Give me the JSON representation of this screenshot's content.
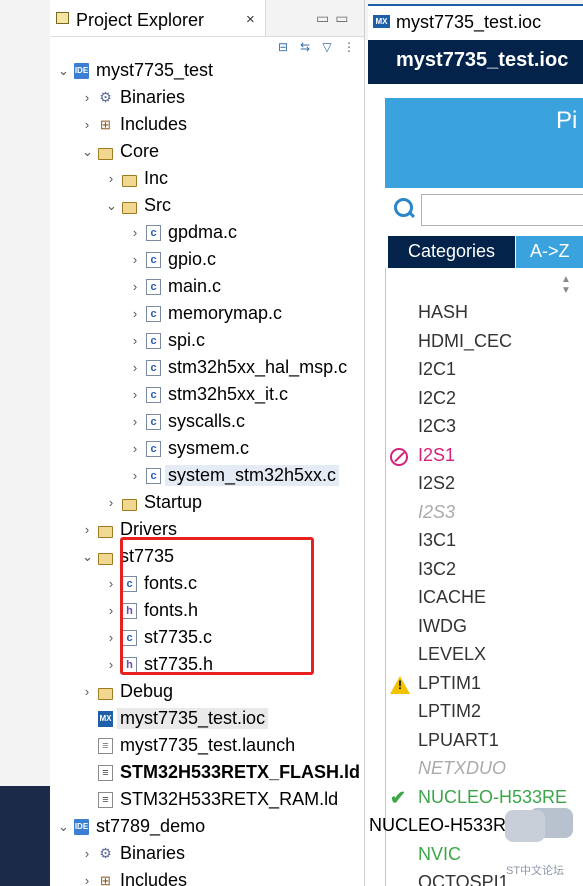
{
  "project_explorer": {
    "tab_title": "Project Explorer",
    "tab_close": "×",
    "min_max": "▭▭",
    "toolbar": [
      "collapse-all-icon",
      "link-with-editor-icon",
      "filter-icon",
      "view-menu-icon"
    ],
    "tree": [
      {
        "label": "myst7735_test",
        "icon": "project-icon",
        "toggle": "v",
        "indent": 0
      },
      {
        "label": "Binaries",
        "icon": "binaries-icon",
        "toggle": ">",
        "indent": 1
      },
      {
        "label": "Includes",
        "icon": "includes-icon",
        "toggle": ">",
        "indent": 1
      },
      {
        "label": "Core",
        "icon": "folder-icon",
        "toggle": "v",
        "indent": 1
      },
      {
        "label": "Inc",
        "icon": "folder-icon",
        "toggle": ">",
        "indent": 2
      },
      {
        "label": "Src",
        "icon": "folder-icon",
        "toggle": "v",
        "indent": 2
      },
      {
        "label": "gpdma.c",
        "icon": "c-file-icon",
        "toggle": ">",
        "indent": 3
      },
      {
        "label": "gpio.c",
        "icon": "c-file-icon",
        "toggle": ">",
        "indent": 3
      },
      {
        "label": "main.c",
        "icon": "c-file-icon",
        "toggle": ">",
        "indent": 3
      },
      {
        "label": "memorymap.c",
        "icon": "c-file-icon",
        "toggle": ">",
        "indent": 3
      },
      {
        "label": "spi.c",
        "icon": "c-file-icon",
        "toggle": ">",
        "indent": 3
      },
      {
        "label": "stm32h5xx_hal_msp.c",
        "icon": "c-file-icon",
        "toggle": ">",
        "indent": 3
      },
      {
        "label": "stm32h5xx_it.c",
        "icon": "c-file-icon",
        "toggle": ">",
        "indent": 3
      },
      {
        "label": "syscalls.c",
        "icon": "c-file-icon",
        "toggle": ">",
        "indent": 3
      },
      {
        "label": "sysmem.c",
        "icon": "c-file-icon",
        "toggle": ">",
        "indent": 3
      },
      {
        "label": "system_stm32h5xx.c",
        "icon": "c-file-icon",
        "toggle": ">",
        "indent": 3,
        "selected": true
      },
      {
        "label": "Startup",
        "icon": "folder-icon",
        "toggle": ">",
        "indent": 2
      },
      {
        "label": "Drivers",
        "icon": "folder-icon",
        "toggle": ">",
        "indent": 1
      },
      {
        "label": "st7735",
        "icon": "folder-icon",
        "toggle": "v",
        "indent": 1
      },
      {
        "label": "fonts.c",
        "icon": "c-file-icon",
        "toggle": ">",
        "indent": 2
      },
      {
        "label": "fonts.h",
        "icon": "h-file-icon",
        "toggle": ">",
        "indent": 2
      },
      {
        "label": "st7735.c",
        "icon": "c-file-icon",
        "toggle": ">",
        "indent": 2
      },
      {
        "label": "st7735.h",
        "icon": "h-file-icon",
        "toggle": ">",
        "indent": 2
      },
      {
        "label": "Debug",
        "icon": "folder-icon",
        "toggle": ">",
        "indent": 1
      },
      {
        "label": "myst7735_test.ioc",
        "icon": "mx-file-icon",
        "toggle": "",
        "indent": 1,
        "selected2": true
      },
      {
        "label": "myst7735_test.launch",
        "icon": "launch-file-icon",
        "toggle": "",
        "indent": 1
      },
      {
        "label": "STM32H533RETX_FLASH.ld",
        "icon": "ld-file-icon",
        "toggle": "",
        "indent": 1,
        "bold": true
      },
      {
        "label": "STM32H533RETX_RAM.ld",
        "icon": "ld-file-icon",
        "toggle": "",
        "indent": 1
      },
      {
        "label": "st7789_demo",
        "icon": "project-icon",
        "toggle": "v",
        "indent": 0
      },
      {
        "label": "Binaries",
        "icon": "binaries-icon",
        "toggle": ">",
        "indent": 1
      },
      {
        "label": "Includes",
        "icon": "includes-icon",
        "toggle": ">",
        "indent": 1
      }
    ]
  },
  "editor": {
    "tab_title": "myst7735_test.ioc",
    "header_title": "myst7735_test.ioc",
    "banner_text": "Pi",
    "search_placeholder": "",
    "tab_categories": "Categories",
    "tab_az": "A->Z",
    "colors": {
      "navy": "#03234b",
      "accent": "#3aa3dd",
      "error": "#d6217a",
      "ok": "#3ca64a",
      "warn": "#f2c200"
    },
    "items": [
      {
        "label": "HASH",
        "state": "normal"
      },
      {
        "label": "HDMI_CEC",
        "state": "normal"
      },
      {
        "label": "I2C1",
        "state": "normal"
      },
      {
        "label": "I2C2",
        "state": "normal"
      },
      {
        "label": "I2C3",
        "state": "normal"
      },
      {
        "label": "I2S1",
        "state": "error",
        "icon": "ban-icon"
      },
      {
        "label": "I2S2",
        "state": "normal"
      },
      {
        "label": "I2S3",
        "state": "disabled"
      },
      {
        "label": "I3C1",
        "state": "normal"
      },
      {
        "label": "I3C2",
        "state": "normal"
      },
      {
        "label": "ICACHE",
        "state": "normal"
      },
      {
        "label": "IWDG",
        "state": "normal"
      },
      {
        "label": "LEVELX",
        "state": "normal"
      },
      {
        "label": "LPTIM1",
        "state": "normal",
        "icon": "warning-icon"
      },
      {
        "label": "LPTIM2",
        "state": "normal"
      },
      {
        "label": "LPUART1",
        "state": "normal"
      },
      {
        "label": "NETXDUO",
        "state": "disabled"
      },
      {
        "label": "NUCLEO-H533RE",
        "state": "ok",
        "icon": "check-icon"
      },
      {
        "label": "NUCLEO-H533RE",
        "state": "plain"
      },
      {
        "label": "NVIC",
        "state": "ok"
      },
      {
        "label": "OCTOSPI1",
        "state": "normal"
      }
    ]
  },
  "watermark": {
    "text": "ST中文论坛"
  }
}
